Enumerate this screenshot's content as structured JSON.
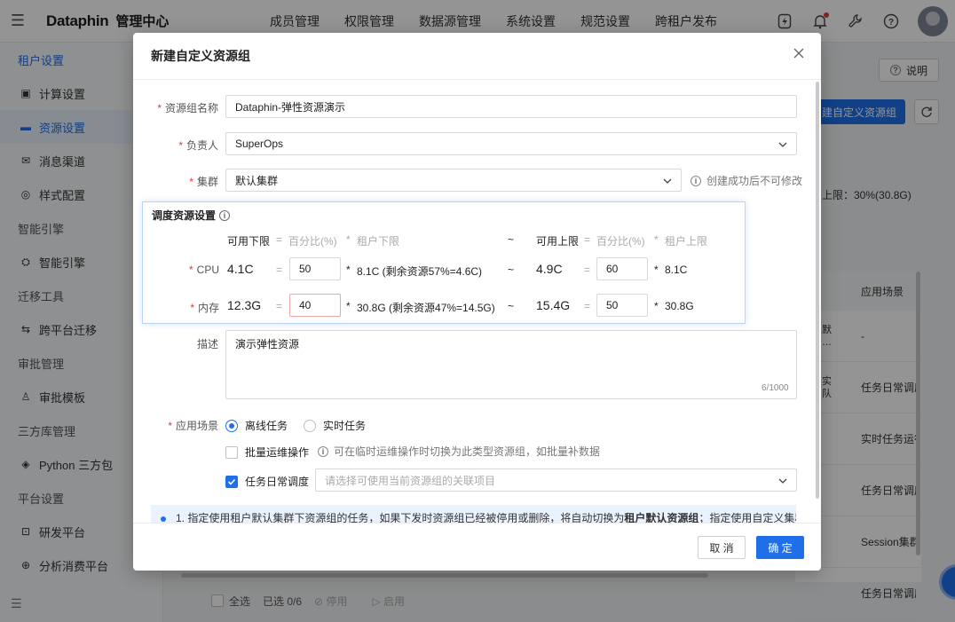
{
  "topbar": {
    "logo": "Dataphin",
    "subtitle": "管理中心",
    "nav": [
      "成员管理",
      "权限管理",
      "数据源管理",
      "系统设置",
      "规范设置",
      "跨租户发布"
    ]
  },
  "sidebar": {
    "groups": [
      {
        "label": "租户设置",
        "items": [
          {
            "label": "计算设置",
            "icon": "cpu-icon"
          },
          {
            "label": "资源设置",
            "icon": "resource-icon"
          },
          {
            "label": "消息渠道",
            "icon": "mail-icon"
          },
          {
            "label": "样式配置",
            "icon": "style-icon"
          }
        ]
      },
      {
        "label": "智能引擎",
        "items": [
          {
            "label": "智能引擎",
            "icon": "engine-icon"
          }
        ]
      },
      {
        "label": "迁移工具",
        "items": [
          {
            "label": "跨平台迁移",
            "icon": "migrate-icon"
          }
        ]
      },
      {
        "label": "审批管理",
        "items": [
          {
            "label": "审批模板",
            "icon": "template-icon"
          }
        ]
      },
      {
        "label": "三方库管理",
        "items": [
          {
            "label": "Python 三方包",
            "icon": "python-icon"
          }
        ]
      },
      {
        "label": "平台设置",
        "items": [
          {
            "label": "研发平台",
            "icon": "dev-icon"
          },
          {
            "label": "分析消费平台",
            "icon": "analysis-icon"
          }
        ]
      }
    ]
  },
  "background": {
    "help": "说明",
    "new_button": "建自定义资源组",
    "limit_text": "上限：30%(30.8G)",
    "table_header": "应用场景",
    "rows": [
      {
        "c1": "默\n…",
        "c2": "-"
      },
      {
        "c1": "实\n队",
        "c2": "任务日常调度"
      },
      {
        "c1": "",
        "c2": "实时任务运行"
      },
      {
        "c1": "",
        "c2": "任务日常调度"
      },
      {
        "c1": "",
        "c2": "Session集群"
      },
      {
        "c1": "",
        "c2": "任务日常调度"
      }
    ],
    "footer": {
      "select_all": "全选",
      "selected": "已选 0/6",
      "disable": "停用",
      "enable": "启用"
    }
  },
  "modal": {
    "title": "新建自定义资源组",
    "fields": {
      "name_label": "资源组名称",
      "name_value": "Dataphin-弹性资源演示",
      "owner_label": "负责人",
      "owner_value": "SuperOps",
      "cluster_label": "集群",
      "cluster_value": "默认集群",
      "cluster_hint": "创建成功后不可修改"
    },
    "schedule": {
      "title": "调度资源设置",
      "header": {
        "lower": "可用下限",
        "eq": "=",
        "pct": "百分比(%)",
        "star": "*",
        "tenant_lower": "租户下限",
        "tilde": "~",
        "upper": "可用上限",
        "tenant_upper": "租户上限"
      },
      "rows": [
        {
          "label": "CPU",
          "lower": "4.1C",
          "lower_pct": "50",
          "lower_tenant": "8.1C (剩余资源57%=4.6C)",
          "upper": "4.9C",
          "upper_pct": "60",
          "upper_tenant": "8.1C"
        },
        {
          "label": "内存",
          "lower": "12.3G",
          "lower_pct": "40",
          "lower_tenant": "30.8G (剩余资源47%=14.5G)",
          "upper": "15.4G",
          "upper_pct": "50",
          "upper_tenant": "30.8G"
        }
      ]
    },
    "desc_label": "描述",
    "desc_value": "演示弹性资源",
    "desc_counter": "6/1000",
    "scene_label": "应用场景",
    "scene_options": [
      "离线任务",
      "实时任务"
    ],
    "batch_label": "批量运维操作",
    "batch_hint": "可在临时运维操作时切换为此类型资源组，如批量补数据",
    "daily_label": "任务日常调度",
    "daily_placeholder": "请选择可使用当前资源组的关联项目",
    "notice_pre": "1. 指定使用租户默认集群下资源组的任务，如果下发时资源组已经被停用或删除，将自动切换为",
    "notice_bold": "租户默认资源组",
    "notice_post": "；指定使用自定义集群下",
    "cancel": "取 消",
    "ok": "确 定"
  },
  "colors": {
    "primary": "#1e6fe8",
    "required": "#e53935"
  }
}
